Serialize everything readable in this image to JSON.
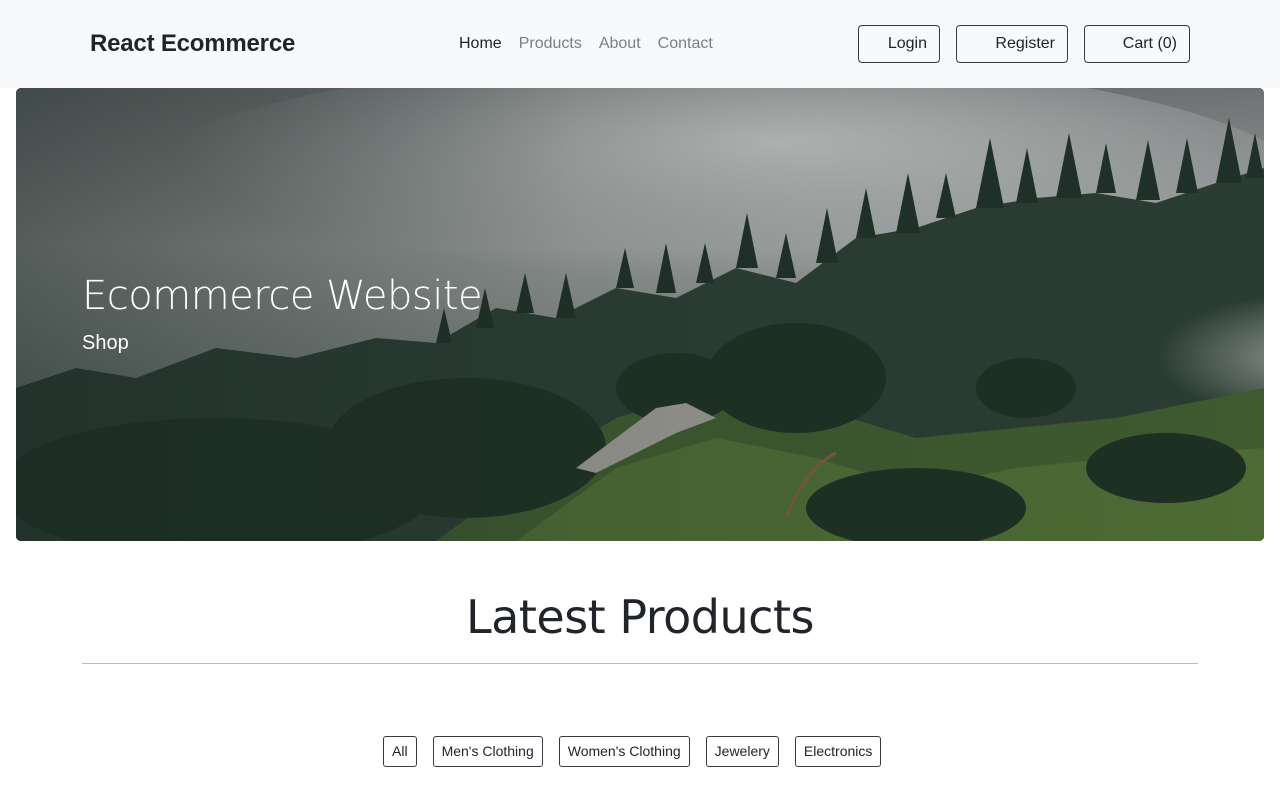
{
  "brand": "React Ecommerce",
  "nav": {
    "links": [
      "Home",
      "Products",
      "About",
      "Contact"
    ],
    "login_label": "Login",
    "register_label": "Register",
    "cart_label": "Cart (0)"
  },
  "hero": {
    "title": "Ecommerce Website",
    "subtitle": "Shop"
  },
  "products": {
    "heading": "Latest Products",
    "filters": [
      "All",
      "Men's Clothing",
      "Women's Clothing",
      "Jewelery",
      "Electronics"
    ]
  },
  "colors": {
    "navbar_bg": "#f8f9fa",
    "text_dark": "#212529",
    "text_muted": "#7a7f84",
    "button_border": "#343a40"
  },
  "icons": {
    "login": "sign-in-icon",
    "register": "user-plus-icon",
    "cart": "shopping-cart-icon"
  }
}
